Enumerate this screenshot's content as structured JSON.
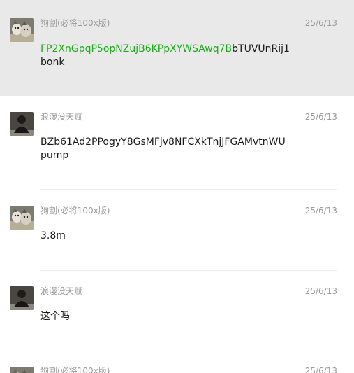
{
  "messages": [
    {
      "sender": "狗割(必将100x版)",
      "time": "25/6/13",
      "content_highlight": "FP2XnGpqP5opNZujB6KPpXYWSAwq7B",
      "content_rest": "bTUVUnRij1",
      "content_line2": "bonk",
      "avatar": "dog-avatar",
      "highlighted": true
    },
    {
      "sender": "浪漫没天赋",
      "time": "25/6/13",
      "content_line1": "BZb61Ad2PPogyY8GsMFjv8NFCXkTnjJFGAMvtnWU",
      "content_line2": "pump",
      "avatar": "person-avatar"
    },
    {
      "sender": "狗割(必将100x版)",
      "time": "25/6/13",
      "content_line1": "3.8m",
      "avatar": "dog-avatar"
    },
    {
      "sender": "浪漫没天赋",
      "time": "25/6/13",
      "content_line1": "这个吗",
      "avatar": "person-avatar"
    },
    {
      "sender": "狗割(必将100x版)",
      "time": "25/6/13",
      "avatar": "dog-avatar"
    }
  ],
  "colors": {
    "highlight_bg": "#e9e9e9",
    "link_green": "#1aad19",
    "meta_gray": "#9a9a9a"
  }
}
